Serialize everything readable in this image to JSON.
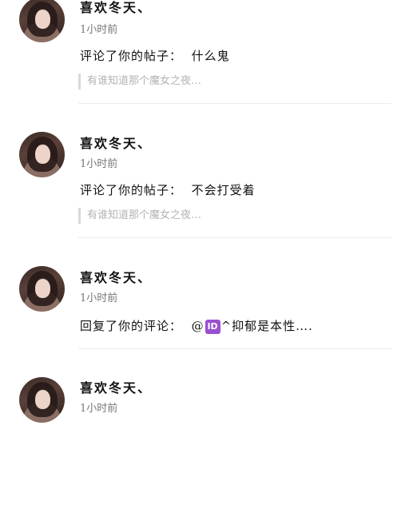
{
  "notifications": [
    {
      "username": "喜欢冬天、",
      "time": "1小时前",
      "action": "评论了你的帖子：",
      "text": "什么鬼",
      "quote": "有谁知道那个魔女之夜…"
    },
    {
      "username": "喜欢冬天、",
      "time": "1小时前",
      "action": "评论了你的帖子：",
      "text": "不会打受着",
      "quote": "有谁知道那个魔女之夜…"
    },
    {
      "username": "喜欢冬天、",
      "time": "1小时前",
      "action": "回复了你的评论：",
      "mention_prefix": "@",
      "mention_badge": "ID",
      "text": "^抑郁是本性…."
    },
    {
      "username": "喜欢冬天、",
      "time": "1小时前"
    }
  ]
}
